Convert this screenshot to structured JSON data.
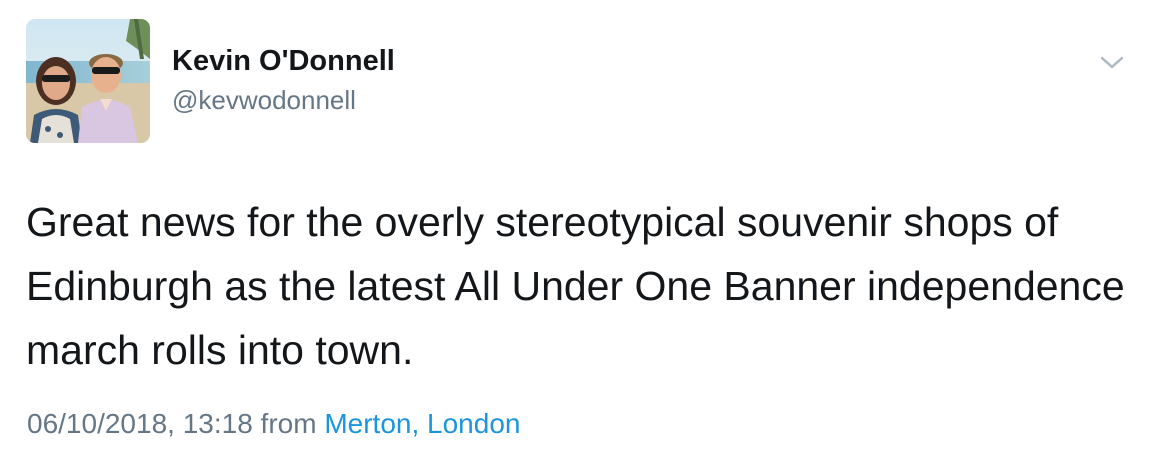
{
  "tweet": {
    "author": {
      "display_name": "Kevin O'Donnell",
      "handle": "@kevwodonnell"
    },
    "text": "Great news for the overly stereotypical souvenir shops of Edinburgh as the latest All Under One Banner independence march rolls into town.",
    "timestamp": "06/10/2018, 13:18",
    "from_label": "from",
    "location": "Merton, London",
    "menu_icon": "chevron-down-icon"
  },
  "colors": {
    "text": "#14171a",
    "secondary_text": "#657786",
    "link": "#1b95e0",
    "chevron": "#aab8c2"
  }
}
